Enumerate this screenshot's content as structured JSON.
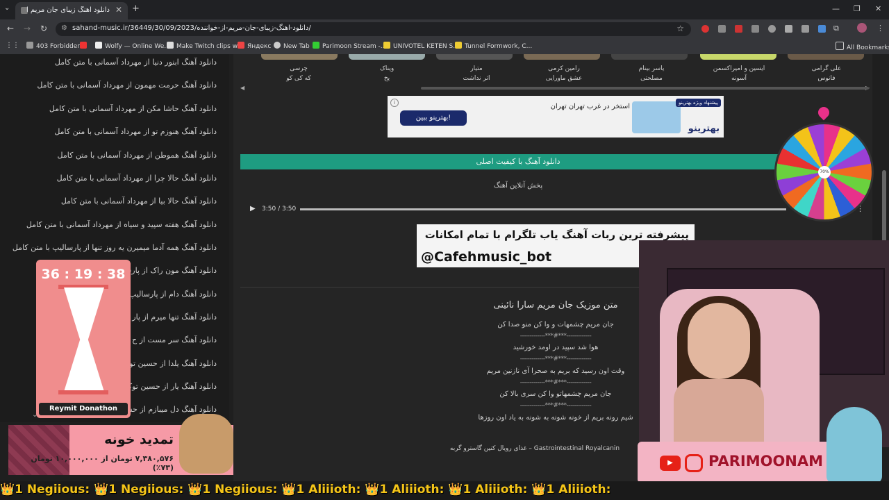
{
  "browser": {
    "tab_title": "دانلود آهنگ زیبای جان مریم از خ",
    "url": "sahand-music.ir/36449/30/09/2023/دانلود-اهنگ-زیبای-جان-مریم-از-خواننده/",
    "new_tab": "+",
    "bookmarks": [
      "403 Forbidden",
      "Wolfy — Online We...",
      "Make Twitch clips w...",
      "Яндекс",
      "New Tab",
      "Parimoon Stream -...",
      "UNIVOTEL KETEN S...",
      "Tunnel Formwork, C..."
    ],
    "all_bookmarks": "All Bookmarks"
  },
  "sidebar": {
    "items": [
      "دانلود آهنگ ابنور دنیا از مهرداد آسمانی با متن کامل",
      "دانلود آهنگ حرمت مهمون از مهرداد آسمانی با متن کامل",
      "دانلود آهنگ حاشا مکن از مهرداد آسمانی با متن کامل",
      "دانلود آهنگ هنوزم تو از مهرداد آسمانی با متن کامل",
      "دانلود آهنگ هموطن از مهرداد آسمانی با متن کامل",
      "دانلود آهنگ حالا چرا از مهرداد آسمانی با متن کامل",
      "دانلود آهنگ حالا بیا از مهرداد آسمانی با متن کامل",
      "دانلود آهنگ هفته سپید و سیاه از مهرداد آسمانی با متن کامل",
      "دانلود آهنگ همه آدما میمیرن یه روز تنها از پارسالیپ با متن کامل",
      "دانلود آهنگ مون راک از پارس",
      "دانلود آهنگ دام از پارسالیپ",
      "دانلود آهنگ تنها میرم از پار",
      "دانلود آهنگ سر مست از ح",
      "دانلود آهنگ یلدا از حسین تو",
      "دانلود آهنگ یار از حسین توک",
      "دانلود آهنگ دل میبازم از حس"
    ]
  },
  "artists": [
    {
      "name": "علی گرامی",
      "song": "فانوس"
    },
    {
      "name": "ایسین و امیراکسمن",
      "song": "آسونه"
    },
    {
      "name": "یاسر بینام",
      "song": "مصلحتی"
    },
    {
      "name": "رامین کرمی",
      "song": "عشق ماورایی"
    },
    {
      "name": "متیار",
      "song": "اثر نداشت"
    },
    {
      "name": "ویناک",
      "song": "یخ"
    },
    {
      "name": "چرسی",
      "song": "که کی کو"
    }
  ],
  "ad": {
    "button": "بهترینو ببین!",
    "text": "استخر در غرب تهران تهران",
    "badge": "پیشنهاد ویژه بهترینو",
    "logo": "بهترینو"
  },
  "download_bar": "دانلود آهنگ با کیفیت اصلی",
  "online_play": "پخش آنلاین آهنگ",
  "player": {
    "time": "3:50 / 3:50"
  },
  "telegram_banner": {
    "line1": "پیشرفته ترین ربات آهنگ یاب تلگرام با تمام امکانات",
    "line2": "@Cafehmusic_bot"
  },
  "lyrics": {
    "title": "متن موزیک جان مریم سارا نائینی",
    "lines": [
      "جان مریم چشمهات و وا کن منو صدا کن",
      "هوا شد سپید در اومد خورشید",
      "وقت اون رسید که بریم به صحرا آی نازنین مریم",
      "جان مریم چشمهاتو وا کن سری بالا کن",
      "شیم رونه بریم از خونه شونه به شونه به یاد اون روزها"
    ],
    "separator": "-------------***#***-------------"
  },
  "footer_link": "غذای رویال کنین گاسترو گربه – Gastrointestinal Royalcanin",
  "stream": {
    "timer": "36 : 19 : 38",
    "timer_label": "Reymit Donathon",
    "wheel_center": "70%",
    "donate_title": "تمدید خونه",
    "donate_amount": "۷,۳۸۰,۵۷۶ تومان از ۱۰,۰۰۰,۰۰۰ تومان (۷۳٪)",
    "social_handle": "PARIMOONAM",
    "ticker": "👑1 Negiious: 👑1 Negiious: 👑1 Negiious: 👑1 Aliiioth: 👑1 Aliiioth: 👑1 Aliiioth: 👑1 Aliiioth:"
  }
}
